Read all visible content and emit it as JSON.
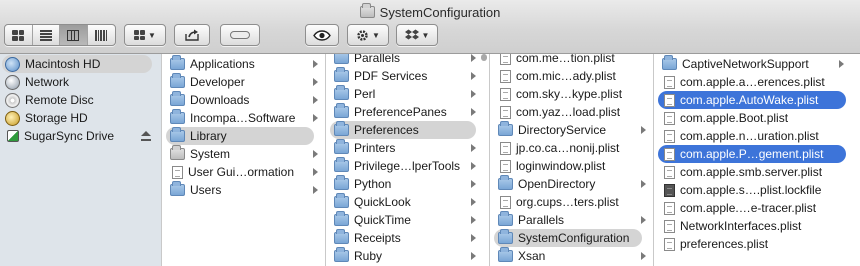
{
  "window": {
    "title": "SystemConfiguration"
  },
  "toolbar": {
    "view_modes": [
      "icon-view",
      "list-view",
      "column-view",
      "coverflow-view"
    ],
    "active_view": "column-view",
    "arrange_icon": "arrange-grid-icon",
    "share_icon": "share-icon",
    "tag_icon": "tag-icon",
    "quicklook_icon": "eye-icon",
    "action_icon": "gear-icon",
    "dropbox_icon": "dropbox-icon"
  },
  "sidebar": {
    "items": [
      {
        "label": "Macintosh HD",
        "icon": "hard-drive-icon",
        "selected": true
      },
      {
        "label": "Network",
        "icon": "network-globe-icon"
      },
      {
        "label": "Remote Disc",
        "icon": "remote-disc-icon"
      },
      {
        "label": "Storage HD",
        "icon": "storage-drive-icon"
      },
      {
        "label": "SugarSync Drive",
        "icon": "sugarsync-icon",
        "eject": true
      }
    ]
  },
  "columns": [
    {
      "items": [
        {
          "label": "Applications"
        },
        {
          "label": "Developer"
        },
        {
          "label": "Downloads"
        },
        {
          "label": "Incompa…Software"
        },
        {
          "label": "Library",
          "selected": "gray"
        },
        {
          "label": "System"
        },
        {
          "label": "User Gui…ormation"
        },
        {
          "label": "Users"
        }
      ]
    },
    {
      "items": [
        {
          "label": "Parallels"
        },
        {
          "label": "PDF Services"
        },
        {
          "label": "Perl"
        },
        {
          "label": "PreferencePanes"
        },
        {
          "label": "Preferences",
          "selected": "gray"
        },
        {
          "label": "Printers"
        },
        {
          "label": "Privilege…lperTools"
        },
        {
          "label": "Python"
        },
        {
          "label": "QuickLook"
        },
        {
          "label": "QuickTime"
        },
        {
          "label": "Receipts"
        },
        {
          "label": "Ruby"
        }
      ]
    },
    {
      "items": [
        {
          "label": "com.me…tion.plist",
          "kind": "file"
        },
        {
          "label": "com.mic…ady.plist",
          "kind": "file"
        },
        {
          "label": "com.sky…kype.plist",
          "kind": "file"
        },
        {
          "label": "com.yaz…load.plist",
          "kind": "file"
        },
        {
          "label": "DirectoryService",
          "kind": "folder"
        },
        {
          "label": "jp.co.ca…nonij.plist",
          "kind": "file"
        },
        {
          "label": "loginwindow.plist",
          "kind": "file"
        },
        {
          "label": "OpenDirectory",
          "kind": "folder"
        },
        {
          "label": "org.cups…ters.plist",
          "kind": "file"
        },
        {
          "label": "Parallels",
          "kind": "folder"
        },
        {
          "label": "SystemConfiguration",
          "kind": "folder",
          "selected": "gray"
        },
        {
          "label": "Xsan",
          "kind": "folder"
        }
      ]
    },
    {
      "items": [
        {
          "label": "CaptiveNetworkSupport",
          "kind": "folder"
        },
        {
          "label": "com.apple.a…erences.plist",
          "kind": "file"
        },
        {
          "label": "com.apple.AutoWake.plist",
          "kind": "file",
          "selected": "blue"
        },
        {
          "label": "com.apple.Boot.plist",
          "kind": "file"
        },
        {
          "label": "com.apple.n…uration.plist",
          "kind": "file"
        },
        {
          "label": "com.apple.P…gement.plist",
          "kind": "file",
          "selected": "blue"
        },
        {
          "label": "com.apple.smb.server.plist",
          "kind": "file"
        },
        {
          "label": "com.apple.s….plist.lockfile",
          "kind": "dark-file"
        },
        {
          "label": "com.apple.…e-tracer.plist",
          "kind": "file"
        },
        {
          "label": "NetworkInterfaces.plist",
          "kind": "file"
        },
        {
          "label": "preferences.plist",
          "kind": "file"
        }
      ]
    }
  ],
  "colors": {
    "selection_blue": "#3d74d9",
    "selection_gray": "#d4d4d4",
    "sidebar_bg": "#dee4ea"
  }
}
